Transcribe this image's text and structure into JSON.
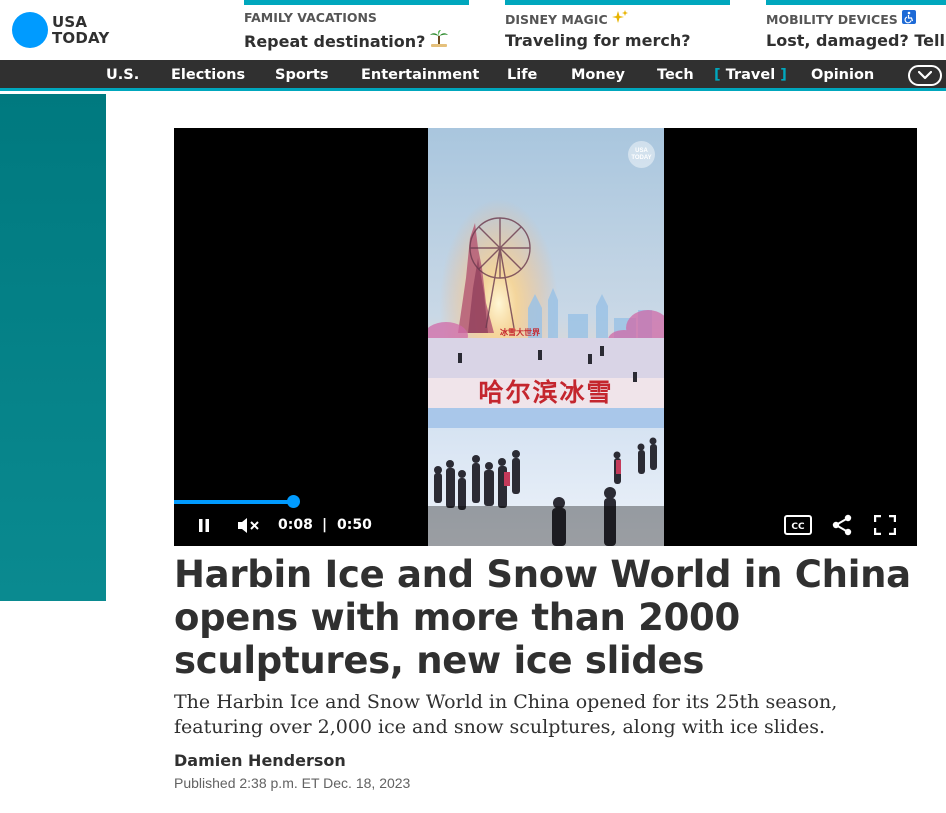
{
  "logo": {
    "line1": "USA",
    "line2": "TODAY",
    "color": "#009bff"
  },
  "promos": [
    {
      "category": "FAMILY VACATIONS",
      "title": "Repeat destination?",
      "icon": "palm-tree-icon",
      "emoji": "🏝"
    },
    {
      "category": "DISNEY MAGIC",
      "title": "Traveling for merch?",
      "icon": "sparkles-icon",
      "emoji": "✨"
    },
    {
      "category": "MOBILITY DEVICES",
      "title": "Lost, damaged? Tell",
      "icon": "wheelchair-icon",
      "emoji": "♿"
    }
  ],
  "nav": {
    "items": [
      "U.S.",
      "Elections",
      "Sports",
      "Entertainment",
      "Life",
      "Money",
      "Tech",
      "Travel",
      "Opinion"
    ],
    "active": "Travel",
    "active_brackets": [
      "[",
      "]"
    ]
  },
  "video": {
    "watermark": "USA TODAY",
    "sign_text": "哈尔滨冰雪",
    "banner_text": "冰雪大世界",
    "current_time": "0:08",
    "separator": "|",
    "duration": "0:50",
    "progress_fraction": 0.16,
    "cc_label": "CC",
    "accent": "#009bff"
  },
  "article": {
    "headline": "Harbin Ice and Snow World in China opens with more than 2000 sculptures, new ice slides",
    "summary": "The Harbin Ice and Snow World in China opened for its 25th season, featuring over 2,000 ice and snow sculptures, along with ice slides.",
    "author": "Damien Henderson",
    "published": "Published 2:38 p.m. ET Dec. 18, 2023"
  },
  "colors": {
    "nav_bg": "#303030",
    "teal": "#00a7bd",
    "side_panel": "#00797f"
  }
}
